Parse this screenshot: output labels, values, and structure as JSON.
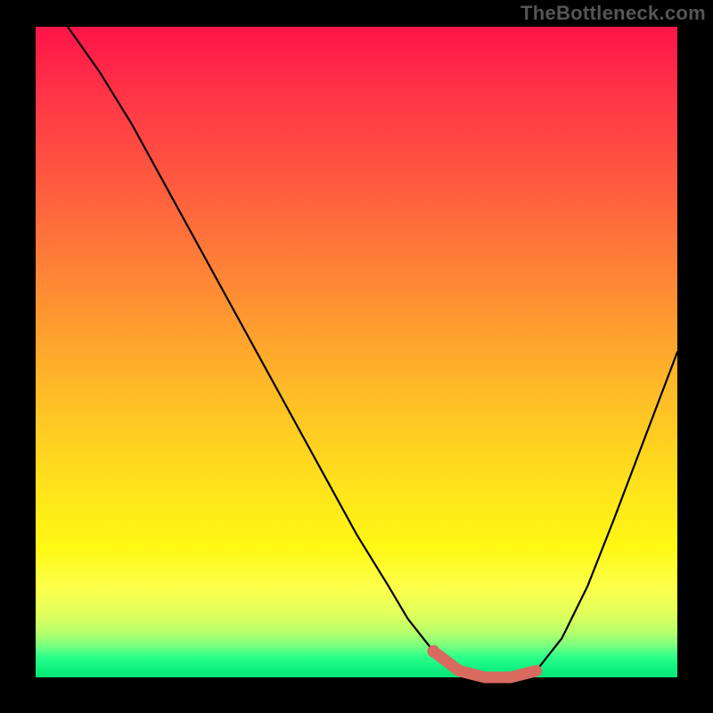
{
  "attribution": "TheBottleneck.com",
  "chart_data": {
    "type": "line",
    "title": "",
    "xlabel": "",
    "ylabel": "",
    "xlim": [
      0,
      100
    ],
    "ylim": [
      0,
      100
    ],
    "series": [
      {
        "name": "bottleneck-curve",
        "x": [
          5,
          10,
          15,
          20,
          25,
          30,
          35,
          40,
          45,
          50,
          55,
          58,
          62,
          66,
          70,
          74,
          78,
          82,
          86,
          90,
          95,
          100
        ],
        "y": [
          100,
          93,
          85,
          76,
          67,
          58,
          49,
          40,
          31,
          22,
          14,
          9,
          4,
          1,
          0,
          0,
          1,
          6,
          14,
          24,
          37,
          50
        ]
      }
    ],
    "highlight": {
      "name": "optimal-range",
      "x": [
        62,
        66,
        70,
        74,
        78
      ],
      "y": [
        4,
        1,
        0,
        0,
        1
      ],
      "color": "#d86a60"
    },
    "background_gradient": {
      "top": "#ff1448",
      "mid": "#ffe11c",
      "bottom": "#00e676"
    }
  }
}
